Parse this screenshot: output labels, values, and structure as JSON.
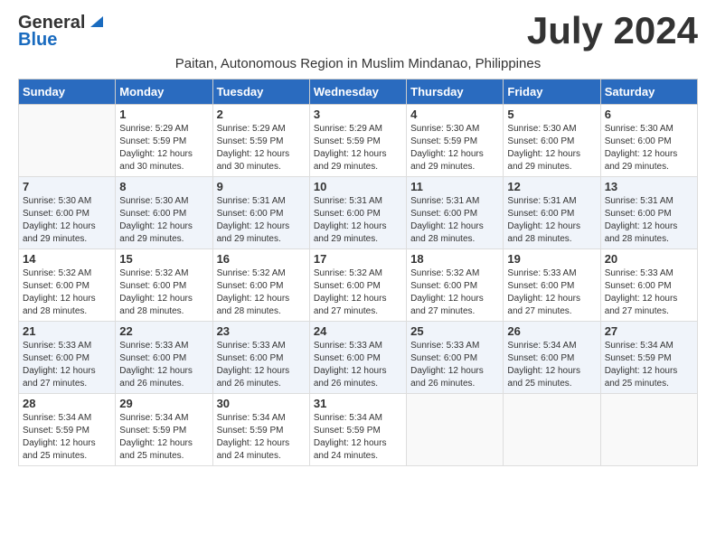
{
  "logo": {
    "general": "General",
    "blue": "Blue"
  },
  "title": "July 2024",
  "subtitle": "Paitan, Autonomous Region in Muslim Mindanao, Philippines",
  "days_of_week": [
    "Sunday",
    "Monday",
    "Tuesday",
    "Wednesday",
    "Thursday",
    "Friday",
    "Saturday"
  ],
  "weeks": [
    [
      {
        "num": "",
        "detail": ""
      },
      {
        "num": "1",
        "detail": "Sunrise: 5:29 AM\nSunset: 5:59 PM\nDaylight: 12 hours\nand 30 minutes."
      },
      {
        "num": "2",
        "detail": "Sunrise: 5:29 AM\nSunset: 5:59 PM\nDaylight: 12 hours\nand 30 minutes."
      },
      {
        "num": "3",
        "detail": "Sunrise: 5:29 AM\nSunset: 5:59 PM\nDaylight: 12 hours\nand 29 minutes."
      },
      {
        "num": "4",
        "detail": "Sunrise: 5:30 AM\nSunset: 5:59 PM\nDaylight: 12 hours\nand 29 minutes."
      },
      {
        "num": "5",
        "detail": "Sunrise: 5:30 AM\nSunset: 6:00 PM\nDaylight: 12 hours\nand 29 minutes."
      },
      {
        "num": "6",
        "detail": "Sunrise: 5:30 AM\nSunset: 6:00 PM\nDaylight: 12 hours\nand 29 minutes."
      }
    ],
    [
      {
        "num": "7",
        "detail": "Sunrise: 5:30 AM\nSunset: 6:00 PM\nDaylight: 12 hours\nand 29 minutes."
      },
      {
        "num": "8",
        "detail": "Sunrise: 5:30 AM\nSunset: 6:00 PM\nDaylight: 12 hours\nand 29 minutes."
      },
      {
        "num": "9",
        "detail": "Sunrise: 5:31 AM\nSunset: 6:00 PM\nDaylight: 12 hours\nand 29 minutes."
      },
      {
        "num": "10",
        "detail": "Sunrise: 5:31 AM\nSunset: 6:00 PM\nDaylight: 12 hours\nand 29 minutes."
      },
      {
        "num": "11",
        "detail": "Sunrise: 5:31 AM\nSunset: 6:00 PM\nDaylight: 12 hours\nand 28 minutes."
      },
      {
        "num": "12",
        "detail": "Sunrise: 5:31 AM\nSunset: 6:00 PM\nDaylight: 12 hours\nand 28 minutes."
      },
      {
        "num": "13",
        "detail": "Sunrise: 5:31 AM\nSunset: 6:00 PM\nDaylight: 12 hours\nand 28 minutes."
      }
    ],
    [
      {
        "num": "14",
        "detail": "Sunrise: 5:32 AM\nSunset: 6:00 PM\nDaylight: 12 hours\nand 28 minutes."
      },
      {
        "num": "15",
        "detail": "Sunrise: 5:32 AM\nSunset: 6:00 PM\nDaylight: 12 hours\nand 28 minutes."
      },
      {
        "num": "16",
        "detail": "Sunrise: 5:32 AM\nSunset: 6:00 PM\nDaylight: 12 hours\nand 28 minutes."
      },
      {
        "num": "17",
        "detail": "Sunrise: 5:32 AM\nSunset: 6:00 PM\nDaylight: 12 hours\nand 27 minutes."
      },
      {
        "num": "18",
        "detail": "Sunrise: 5:32 AM\nSunset: 6:00 PM\nDaylight: 12 hours\nand 27 minutes."
      },
      {
        "num": "19",
        "detail": "Sunrise: 5:33 AM\nSunset: 6:00 PM\nDaylight: 12 hours\nand 27 minutes."
      },
      {
        "num": "20",
        "detail": "Sunrise: 5:33 AM\nSunset: 6:00 PM\nDaylight: 12 hours\nand 27 minutes."
      }
    ],
    [
      {
        "num": "21",
        "detail": "Sunrise: 5:33 AM\nSunset: 6:00 PM\nDaylight: 12 hours\nand 27 minutes."
      },
      {
        "num": "22",
        "detail": "Sunrise: 5:33 AM\nSunset: 6:00 PM\nDaylight: 12 hours\nand 26 minutes."
      },
      {
        "num": "23",
        "detail": "Sunrise: 5:33 AM\nSunset: 6:00 PM\nDaylight: 12 hours\nand 26 minutes."
      },
      {
        "num": "24",
        "detail": "Sunrise: 5:33 AM\nSunset: 6:00 PM\nDaylight: 12 hours\nand 26 minutes."
      },
      {
        "num": "25",
        "detail": "Sunrise: 5:33 AM\nSunset: 6:00 PM\nDaylight: 12 hours\nand 26 minutes."
      },
      {
        "num": "26",
        "detail": "Sunrise: 5:34 AM\nSunset: 6:00 PM\nDaylight: 12 hours\nand 25 minutes."
      },
      {
        "num": "27",
        "detail": "Sunrise: 5:34 AM\nSunset: 5:59 PM\nDaylight: 12 hours\nand 25 minutes."
      }
    ],
    [
      {
        "num": "28",
        "detail": "Sunrise: 5:34 AM\nSunset: 5:59 PM\nDaylight: 12 hours\nand 25 minutes."
      },
      {
        "num": "29",
        "detail": "Sunrise: 5:34 AM\nSunset: 5:59 PM\nDaylight: 12 hours\nand 25 minutes."
      },
      {
        "num": "30",
        "detail": "Sunrise: 5:34 AM\nSunset: 5:59 PM\nDaylight: 12 hours\nand 24 minutes."
      },
      {
        "num": "31",
        "detail": "Sunrise: 5:34 AM\nSunset: 5:59 PM\nDaylight: 12 hours\nand 24 minutes."
      },
      {
        "num": "",
        "detail": ""
      },
      {
        "num": "",
        "detail": ""
      },
      {
        "num": "",
        "detail": ""
      }
    ]
  ]
}
